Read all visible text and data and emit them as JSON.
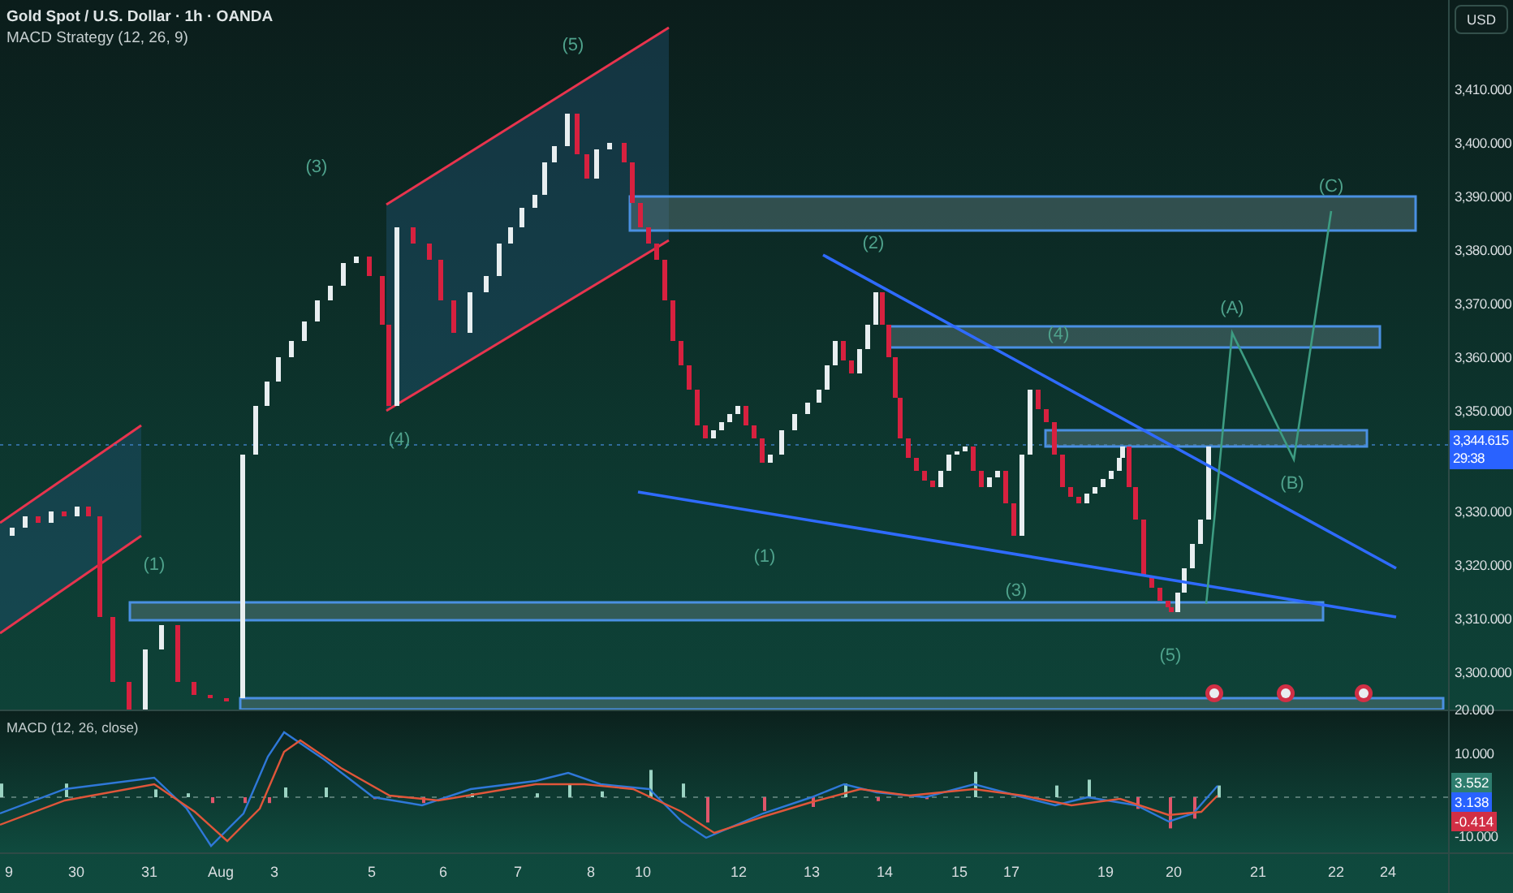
{
  "header": {
    "symbol": "Gold Spot / U.S. Dollar · 1h · OANDA",
    "indicator": "MACD Strategy (12, 26, 9)"
  },
  "currency_button": "USD",
  "price_axis": {
    "ticks": [
      "3,410.000",
      "3,400.000",
      "3,390.000",
      "3,380.000",
      "3,370.000",
      "3,360.000",
      "3,350.000",
      "3,330.000",
      "3,320.000",
      "3,310.000",
      "3,300.000"
    ],
    "current_price": "3,344.615",
    "countdown": "29:38"
  },
  "wave_labels": [
    {
      "text": "(5)"
    },
    {
      "text": "(3)"
    },
    {
      "text": "(4)"
    },
    {
      "text": "(1)"
    },
    {
      "text": "(2)"
    },
    {
      "text": "(1)"
    },
    {
      "text": "(4)"
    },
    {
      "text": "(3)"
    },
    {
      "text": "(5)"
    },
    {
      "text": "(A)"
    },
    {
      "text": "(B)"
    },
    {
      "text": "(C)"
    }
  ],
  "macd": {
    "title": "MACD (12, 26, close)",
    "axis_ticks": [
      "20.000",
      "10.000",
      "-10.000"
    ],
    "value_badges": [
      {
        "text": "3.552",
        "color": "#2e7d6e"
      },
      {
        "text": "3.138",
        "color": "#2962ff"
      },
      {
        "text": "-0.414",
        "color": "#d12f45"
      }
    ]
  },
  "time_axis": [
    "9",
    "30",
    "31",
    "Aug",
    "3",
    "5",
    "6",
    "7",
    "8",
    "10",
    "12",
    "13",
    "14",
    "15",
    "17",
    "19",
    "20",
    "21",
    "22",
    "24"
  ]
}
